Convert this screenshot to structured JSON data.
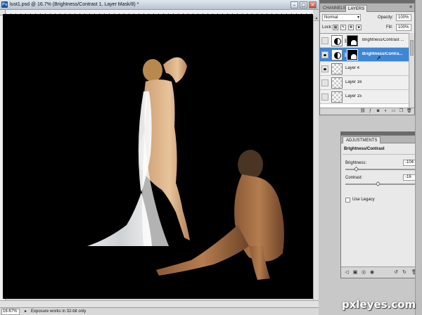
{
  "document": {
    "app_icon": "Ps",
    "title": "lust1.psd @ 16.7% (Brightness/Contrast 1, Layer Mask/8) *",
    "zoom": "16.67%",
    "status_text": "Exposure works in 32-bit only"
  },
  "layers_panel": {
    "tabs": [
      "CHANNELS",
      "LAYERS"
    ],
    "active_tab": "LAYERS",
    "blend_mode": "Normal",
    "opacity_label": "Opacity:",
    "opacity": "100%",
    "lock_label": "Lock:",
    "fill_label": "Fill:",
    "fill": "100%",
    "layers": [
      {
        "name": "Brightness/Contrast ...",
        "type": "adjustment",
        "visible": false,
        "selected": false
      },
      {
        "name": "Brightness/Contra...",
        "type": "adjustment",
        "visible": true,
        "selected": true
      },
      {
        "name": "Layer 4",
        "type": "pixel",
        "visible": true,
        "selected": false
      },
      {
        "name": "Layer 16",
        "type": "pixel",
        "visible": false,
        "selected": false
      },
      {
        "name": "Layer 15",
        "type": "pixel",
        "visible": false,
        "selected": false
      }
    ]
  },
  "adjustments_panel": {
    "tab": "ADJUSTMENTS",
    "heading": "Brightness/Contrast",
    "brightness_label": "Brightness:",
    "brightness": "-104",
    "brightness_fraction": 0.15,
    "contrast_label": "Contrast:",
    "contrast": "-16",
    "contrast_fraction": 0.45,
    "legacy_label": "Use Legacy",
    "legacy_checked": false
  },
  "watermark": "pxleyes.com",
  "colors": {
    "selection": "#3e86d6",
    "canvas": "#000000",
    "panel": "#e9e9e9"
  }
}
